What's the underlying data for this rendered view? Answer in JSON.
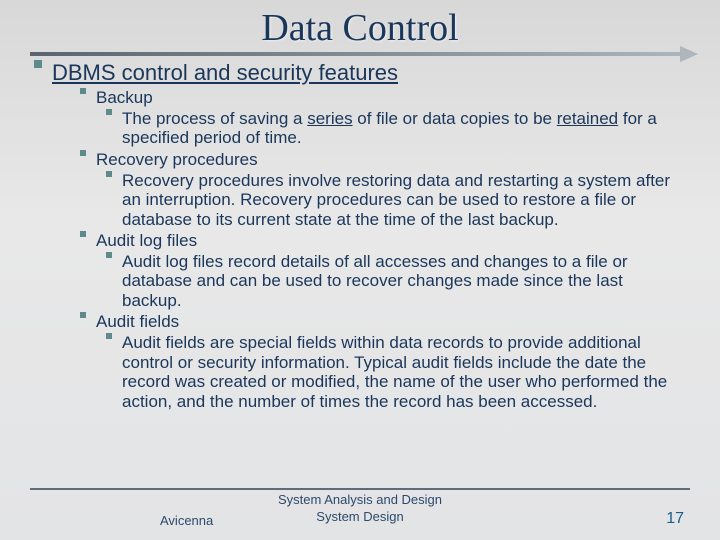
{
  "title": "Data Control",
  "heading": "DBMS control and security features",
  "items": [
    {
      "label": "Backup",
      "sub": [
        {
          "pre": "The process of saving a ",
          "u1": "series",
          "mid": " of file or data copies to be ",
          "u2": "retained",
          "post": " for a specified period of time."
        }
      ]
    },
    {
      "label": "Recovery procedures",
      "sub": [
        {
          "text": "Recovery procedures involve restoring data and restarting a system after an interruption. Recovery procedures can be used to restore a file or database to its current state at the time of the last backup."
        }
      ]
    },
    {
      "label": "Audit log files",
      "sub": [
        {
          "text": "Audit log files record details of all accesses and changes to a file or database and can be used to recover changes made since the last backup."
        }
      ]
    },
    {
      "label": "Audit fields",
      "sub": [
        {
          "text": "Audit fields are special fields within data records to provide additional control or security information. Typical audit fields include the date the record was created or modified, the name of the user who performed the action, and the number of times the record has been accessed."
        }
      ]
    }
  ],
  "footer": {
    "line1": "System Analysis and Design",
    "left": "Avicenna",
    "line2": "System Design",
    "page": "17"
  }
}
